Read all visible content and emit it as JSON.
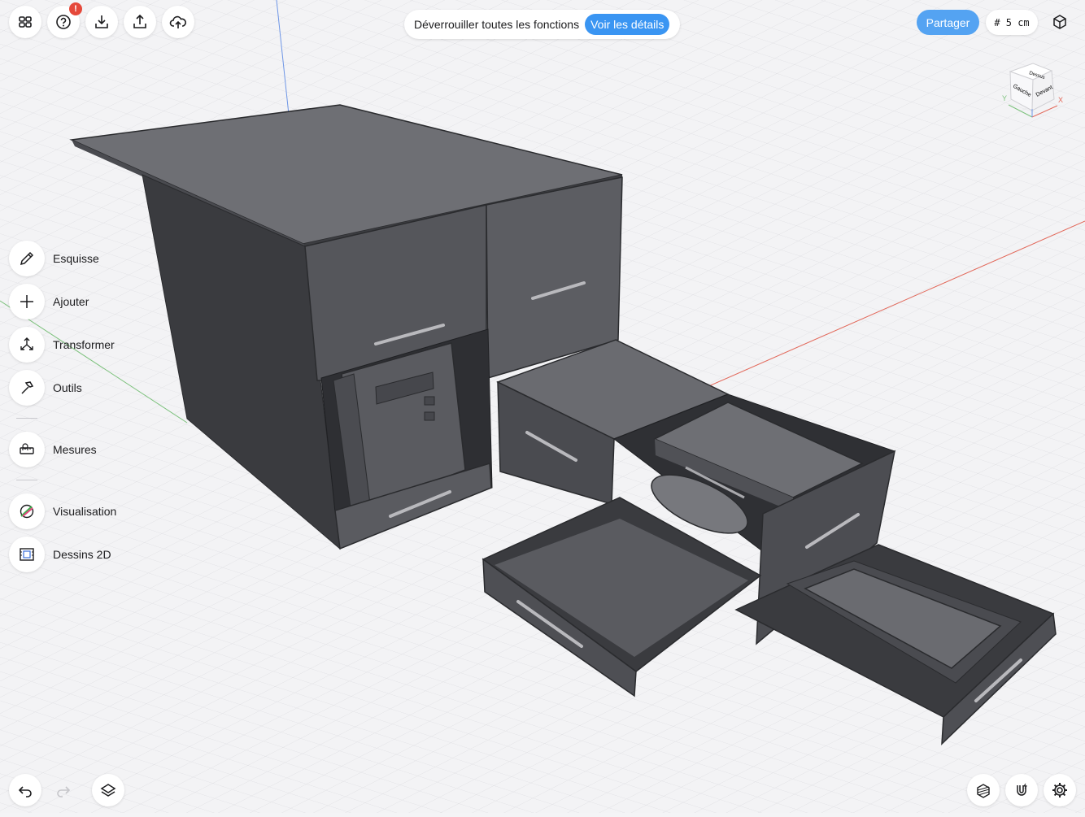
{
  "toolbar": {
    "help_badge": "!",
    "promo_text": "Déverrouiller toutes les fonctions",
    "promo_button": "Voir les détails",
    "share_label": "Partager",
    "grid_label": "# 5 cm"
  },
  "tools": [
    {
      "label": "Esquisse",
      "icon": "pencil-icon"
    },
    {
      "label": "Ajouter",
      "icon": "plus-icon"
    },
    {
      "label": "Transformer",
      "icon": "transform-icon"
    },
    {
      "label": "Outils",
      "icon": "hammer-icon"
    },
    {
      "label": "Mesures",
      "icon": "tape-measure-icon"
    },
    {
      "label": "Visualisation",
      "icon": "palette-icon"
    },
    {
      "label": "Dessins 2D",
      "icon": "blueprint-icon"
    }
  ],
  "viewcube": {
    "top": "Dessus",
    "left": "Gauche",
    "right": "Devant",
    "x_axis": "X",
    "y_axis": "Y",
    "colors": {
      "x": "#e2685a",
      "y": "#7cc17c",
      "z": "#6d95e6"
    }
  },
  "colors": {
    "accent": "#3a95f2",
    "model_dark": "#3d3e42",
    "model_mid": "#55565b",
    "model_light": "#6d6e73",
    "canvas": "#f4f4f6"
  }
}
